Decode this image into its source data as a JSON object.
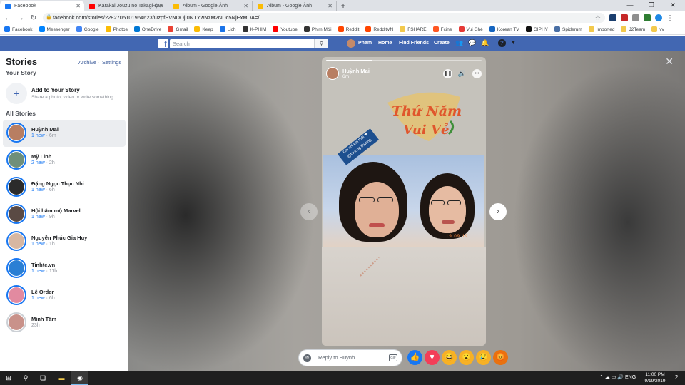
{
  "browser": {
    "tabs": [
      {
        "label": "Facebook",
        "active": true,
        "favicon_color": "#1877f2"
      },
      {
        "label": "Karakai Jouzu no Takagi-san",
        "active": false,
        "favicon_color": "#ff0000"
      },
      {
        "label": "Album - Google Ảnh",
        "active": false,
        "favicon_color": "#fbbc04"
      },
      {
        "label": "Album - Google Ảnh",
        "active": false,
        "favicon_color": "#fbbc04"
      }
    ],
    "new_tab": "+",
    "url": "facebook.com/stories/2282705101964623/UzpfSVNDOjI0NTYwNzM2NDc5NjExMDA=/",
    "bookmarks": [
      {
        "label": "Facebook",
        "color": "#1877f2"
      },
      {
        "label": "Messenger",
        "color": "#0084ff"
      },
      {
        "label": "Google",
        "color": "#4285f4"
      },
      {
        "label": "Photos",
        "color": "#fbbc04"
      },
      {
        "label": "OneDrive",
        "color": "#0078d4"
      },
      {
        "label": "Gmail",
        "color": "#ea4335"
      },
      {
        "label": "Keep",
        "color": "#fbbc04"
      },
      {
        "label": "Lich",
        "color": "#1a73e8"
      },
      {
        "label": "K-PHIM",
        "color": "#333333"
      },
      {
        "label": "Youtube",
        "color": "#ff0000"
      },
      {
        "label": "Phim Mới",
        "color": "#333333"
      },
      {
        "label": "Reddit",
        "color": "#ff4500"
      },
      {
        "label": "RedditVN",
        "color": "#ff4500"
      },
      {
        "label": "FSHARE",
        "color": "#f2c94c"
      },
      {
        "label": "Fcine",
        "color": "#ff5722"
      },
      {
        "label": "Vui Ghé",
        "color": "#e53935"
      },
      {
        "label": "Korean TV",
        "color": "#1565c0"
      },
      {
        "label": "GIPHY",
        "color": "#111111"
      },
      {
        "label": "Spiderum",
        "color": "#4a6fa5"
      },
      {
        "label": "Imported",
        "color": "#f2c94c"
      },
      {
        "label": "J2Team",
        "color": "#f2c94c"
      },
      {
        "label": "vv",
        "color": "#f2c94c"
      }
    ]
  },
  "fb": {
    "search_placeholder": "Search",
    "profile_name": "Pham",
    "nav": [
      "Home",
      "Find Friends",
      "Create"
    ],
    "brand_color": "#4267b2"
  },
  "sidebar": {
    "title": "Stories",
    "archive": "Archive",
    "separator": "·",
    "settings": "Settings",
    "your_story_heading": "Your Story",
    "add_title": "Add to Your Story",
    "add_subtitle": "Share a photo, video or write something",
    "all_stories_heading": "All Stories",
    "stories": [
      {
        "name": "Huỳnh Mai",
        "new": "1 new",
        "time": "6m",
        "selected": true,
        "face": "#b87e62"
      },
      {
        "name": "Mỹ Linh",
        "new": "2 new",
        "time": "2h",
        "selected": false,
        "face": "#6f8f7a"
      },
      {
        "name": "Đặng Ngọc Thục Nhi",
        "new": "1 new",
        "time": "6h",
        "selected": false,
        "face": "#2b2b2b"
      },
      {
        "name": "Hội hâm mộ Marvel",
        "new": "1 new",
        "time": "9h",
        "selected": false,
        "face": "#5a4a44"
      },
      {
        "name": "Nguyễn Phúc Gia Huy",
        "new": "1 new",
        "time": "1h",
        "selected": false,
        "face": "#d7b7a2"
      },
      {
        "name": "Tinhte.vn",
        "new": "1 new",
        "time": "11h",
        "selected": false,
        "face": "#2a7fd4"
      },
      {
        "name": "Lê Order",
        "new": "1 new",
        "time": "6h",
        "selected": false,
        "face": "#e28aa0"
      },
      {
        "name": "Minh Tâm",
        "new": "",
        "time": "23h",
        "selected": false,
        "face": "#c9928a"
      }
    ]
  },
  "story": {
    "author": "Huỳnh Mai",
    "time": "6m",
    "progress": 0.3,
    "sticker_text": "Thứ Năm Vui Vẻ",
    "tag_text": "Chi chỉ em thôi ❤ @thuong.thuong",
    "photo_stamp": "19 09 19",
    "reply_placeholder": "Reply to Huỳnh...",
    "gif": "GIF",
    "reactions": [
      {
        "name": "like",
        "glyph": "👍",
        "color": "#1877f2"
      },
      {
        "name": "love",
        "glyph": "♥",
        "color": "#f33e58"
      },
      {
        "name": "haha",
        "glyph": "😆",
        "color": "#f7b125"
      },
      {
        "name": "wow",
        "glyph": "😮",
        "color": "#f7b125"
      },
      {
        "name": "sad",
        "glyph": "😢",
        "color": "#f7b125"
      },
      {
        "name": "angry",
        "glyph": "😡",
        "color": "#e9710f"
      }
    ]
  },
  "taskbar": {
    "time": "11:00 PM",
    "date": "9/19/2019",
    "notifications": "2"
  }
}
